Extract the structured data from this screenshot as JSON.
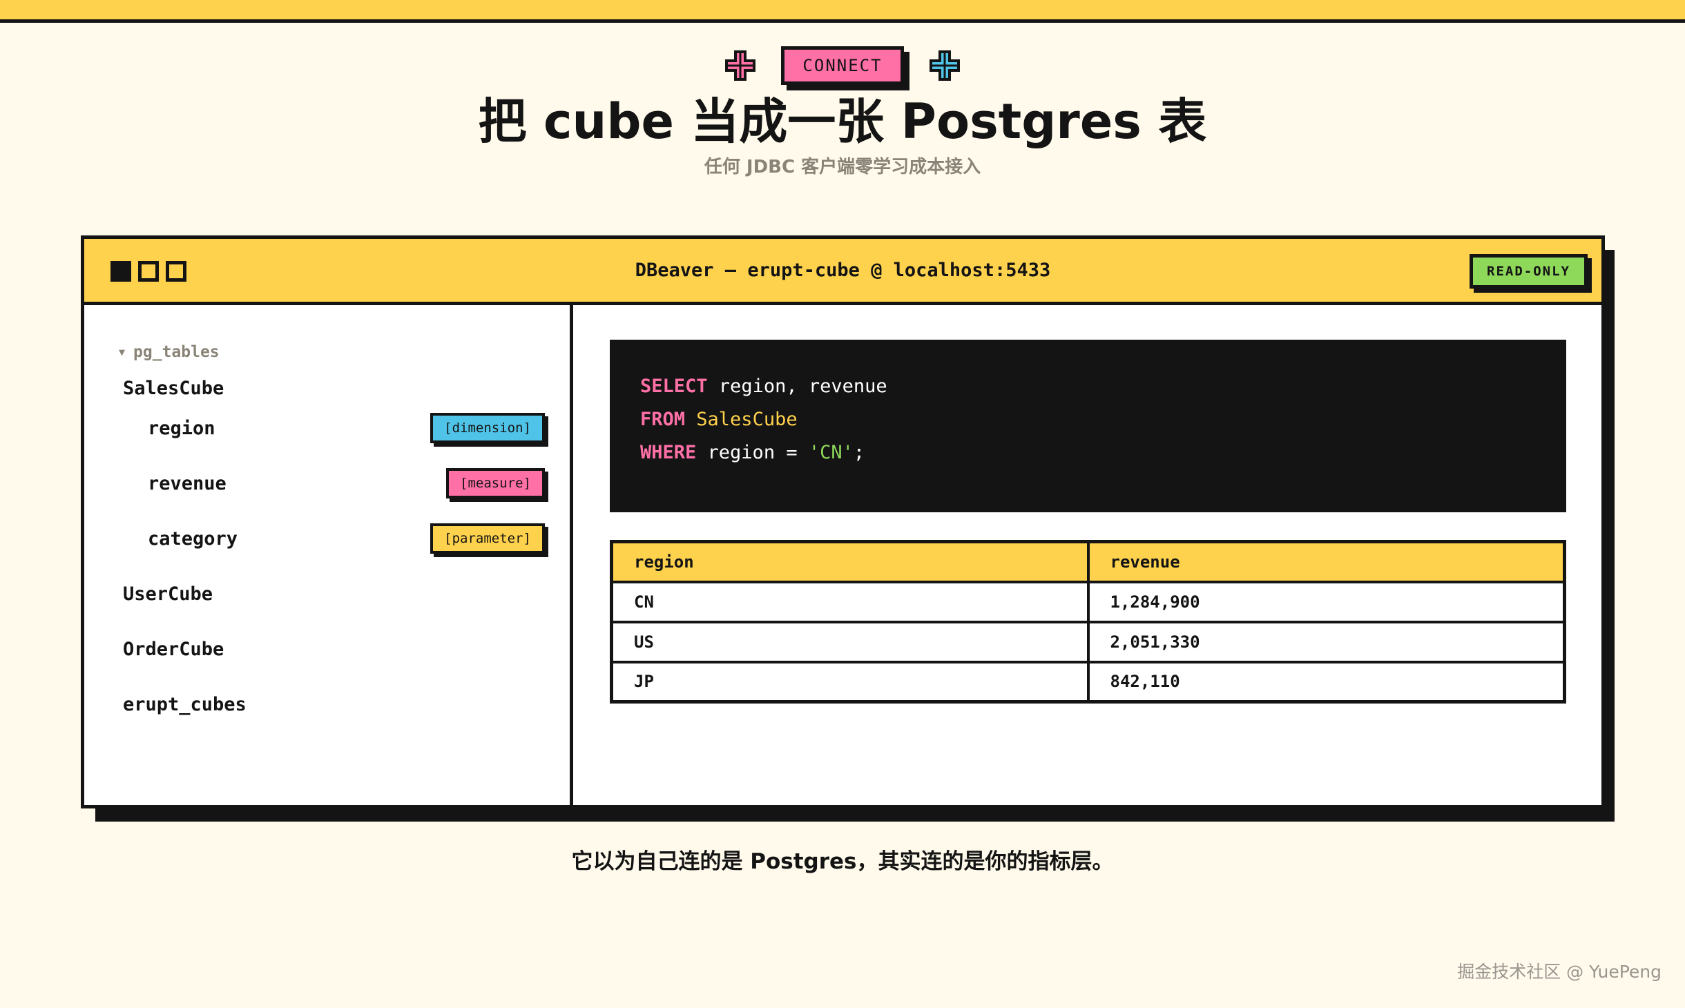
{
  "header": {
    "badge": "CONNECT",
    "title": "把 cube 当成一张 Postgres 表",
    "subtitle": "任何 JDBC 客户端零学习成本接入"
  },
  "window": {
    "title": "DBeaver — erupt-cube @ localhost:5433",
    "status_badge": "READ-ONLY"
  },
  "sidebar": {
    "group": "pg_tables",
    "cube": "SalesCube",
    "fields": [
      {
        "name": "region",
        "tag": "[dimension]",
        "tag_color": "#4fc3e8"
      },
      {
        "name": "revenue",
        "tag": "[measure]",
        "tag_color": "#ff70a6"
      },
      {
        "name": "category",
        "tag": "[parameter]",
        "tag_color": "#ffd24d"
      }
    ],
    "other_items": [
      "UserCube",
      "OrderCube",
      "erupt_cubes"
    ]
  },
  "query": {
    "line1": {
      "kw": "SELECT",
      "rest": " region, revenue"
    },
    "line2": {
      "kw": "FROM",
      "ident": " SalesCube"
    },
    "line3": {
      "kw": "WHERE",
      "mid": " region = ",
      "str": "'CN'",
      "end": ";"
    }
  },
  "results": {
    "columns": [
      "region",
      "revenue"
    ],
    "rows": [
      [
        "CN",
        "1,284,900"
      ],
      [
        "US",
        "2,051,330"
      ],
      [
        "JP",
        "842,110"
      ]
    ]
  },
  "caption": "它以为自己连的是 Postgres，其实连的是你的指标层。",
  "watermark": "掘金技术社区 @ YuePeng",
  "colors": {
    "background": "#fffaeb",
    "yellow": "#ffd24d",
    "pink": "#ff70a6",
    "cyan": "#4fc3e8",
    "green": "#8ed85a",
    "ink": "#141414"
  }
}
